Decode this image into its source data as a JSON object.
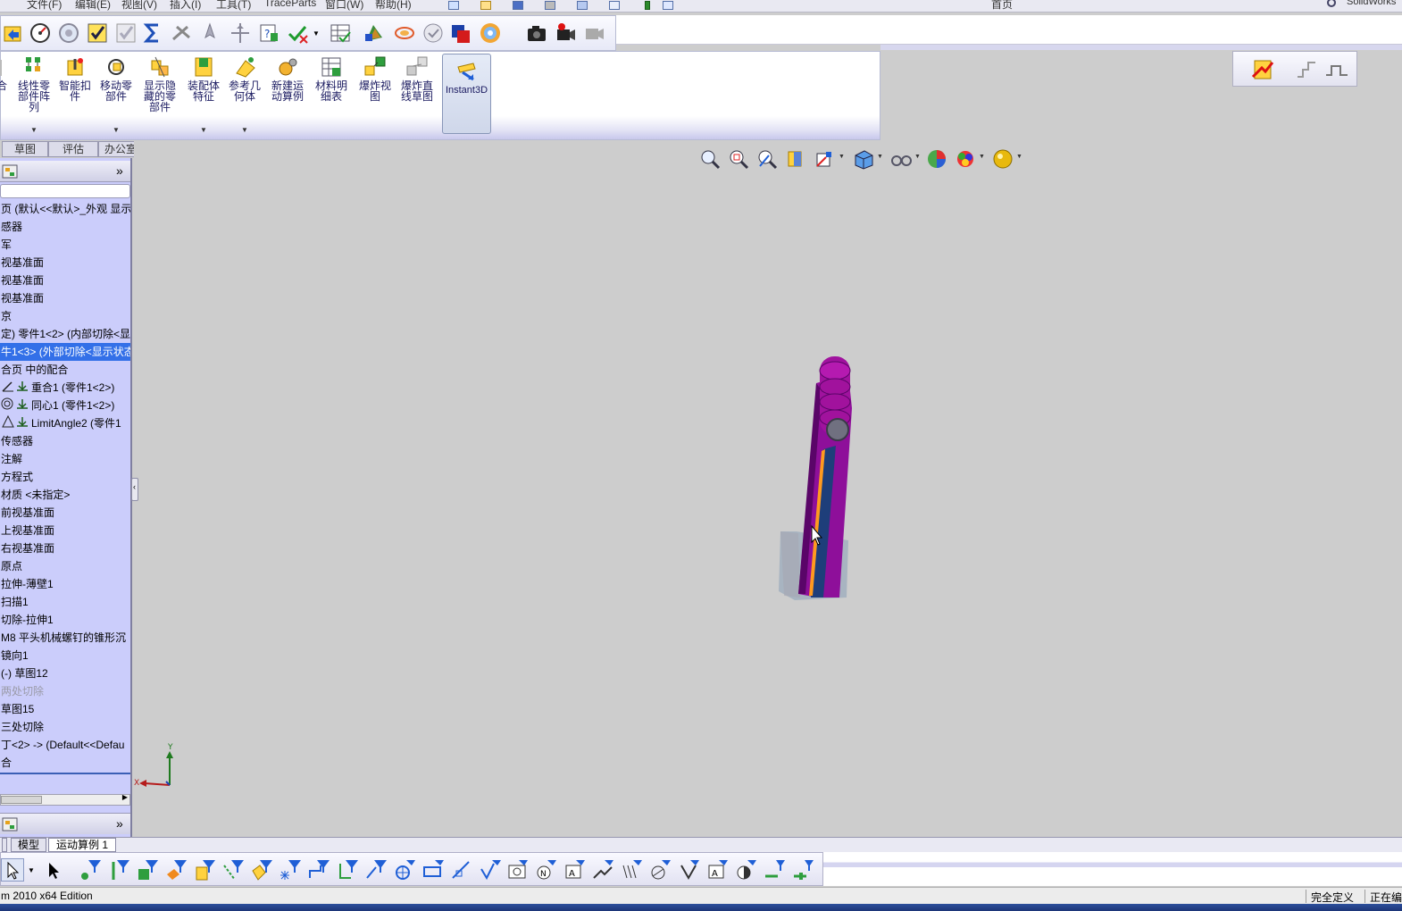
{
  "menu": {
    "items": [
      "文件(F)",
      "编辑(E)",
      "视图(V)",
      "插入(I)",
      "工具(T)",
      "TraceParts",
      "窗口(W)",
      "帮助(H)"
    ],
    "search_scope": "首页",
    "search_product": "SolidWorks"
  },
  "command_manager": {
    "commands": [
      {
        "label": "合",
        "icon": "mate-icon",
        "dropdown": false
      },
      {
        "label": "线性零\n部件阵\n列",
        "icon": "linear-pattern-icon",
        "dropdown": true
      },
      {
        "label": "智能扣\n件",
        "icon": "smart-fastener-icon",
        "dropdown": false
      },
      {
        "label": "移动零\n部件",
        "icon": "move-component-icon",
        "dropdown": true
      },
      {
        "label": "显示隐\n藏的零\n部件",
        "icon": "show-hidden-icon",
        "dropdown": false
      },
      {
        "label": "装配体\n特征",
        "icon": "assembly-feature-icon",
        "dropdown": true
      },
      {
        "label": "参考几\n何体",
        "icon": "reference-geometry-icon",
        "dropdown": true
      },
      {
        "label": "新建运\n动算例",
        "icon": "motion-study-icon",
        "dropdown": false
      },
      {
        "label": "材料明\n细表",
        "icon": "bom-icon",
        "dropdown": false
      },
      {
        "label": "爆炸视\n图",
        "icon": "exploded-view-icon",
        "dropdown": false
      },
      {
        "label": "爆炸直\n线草图",
        "icon": "explode-line-sketch-icon",
        "dropdown": false
      },
      {
        "label": "Instant3D",
        "icon": "instant3d-icon",
        "dropdown": false,
        "active": true
      }
    ],
    "tabs": [
      "草图",
      "评估",
      "办公室产品"
    ]
  },
  "feature_tree": {
    "collapse_glyph": "»",
    "items": [
      {
        "text": "页 (默认<<默认>_外观 显示",
        "state": "normal"
      },
      {
        "text": "感器",
        "state": "normal"
      },
      {
        "text": "军",
        "state": "normal"
      },
      {
        "text": "视基准面",
        "state": "normal"
      },
      {
        "text": "视基准面",
        "state": "normal"
      },
      {
        "text": "视基准面",
        "state": "normal"
      },
      {
        "text": "京",
        "state": "normal"
      },
      {
        "text": "定) 零件1<2> (内部切除<显",
        "state": "normal"
      },
      {
        "text": "牛1<3> (外部切除<显示状态",
        "state": "selected"
      },
      {
        "text": "合页 中的配合",
        "state": "normal"
      },
      {
        "text": "重合1 (零件1<2>)",
        "state": "mate",
        "icon": "coincident-mate-icon"
      },
      {
        "text": "同心1 (零件1<2>)",
        "state": "mate",
        "icon": "concentric-mate-icon"
      },
      {
        "text": "LimitAngle2 (零件1",
        "state": "mate",
        "icon": "limit-angle-mate-icon"
      },
      {
        "text": "传感器",
        "state": "normal"
      },
      {
        "text": "注解",
        "state": "normal"
      },
      {
        "text": "方程式",
        "state": "normal"
      },
      {
        "text": "材质 <未指定>",
        "state": "normal"
      },
      {
        "text": "前视基准面",
        "state": "normal"
      },
      {
        "text": "上视基准面",
        "state": "normal"
      },
      {
        "text": "右视基准面",
        "state": "normal"
      },
      {
        "text": "原点",
        "state": "normal"
      },
      {
        "text": "拉伸-薄壁1",
        "state": "normal"
      },
      {
        "text": "扫描1",
        "state": "normal"
      },
      {
        "text": "切除-拉伸1",
        "state": "normal"
      },
      {
        "text": "M8 平头机械螺钉的锥形沉",
        "state": "normal"
      },
      {
        "text": "镜向1",
        "state": "normal"
      },
      {
        "text": "(-) 草图12",
        "state": "normal"
      },
      {
        "text": "两处切除",
        "state": "dim"
      },
      {
        "text": "草图15",
        "state": "normal"
      },
      {
        "text": "三处切除",
        "state": "normal"
      },
      {
        "text": "丁<2> -> (Default<<Defau",
        "state": "normal"
      },
      {
        "text": "合",
        "state": "normal"
      }
    ]
  },
  "viewport": {
    "triad": {
      "x_label": "X",
      "y_label": "Y"
    },
    "colors": {
      "part_body": "#8e0f9a",
      "part_dark": "#5a0568",
      "face_selected": "#1e3e7a",
      "edge_highlight": "#ff9a1f"
    }
  },
  "bottom_tabs": [
    "模型",
    "运动算例 1"
  ],
  "status": {
    "left": "m 2010 x64 Edition",
    "definition": "完全定义",
    "editing": "正在编"
  }
}
